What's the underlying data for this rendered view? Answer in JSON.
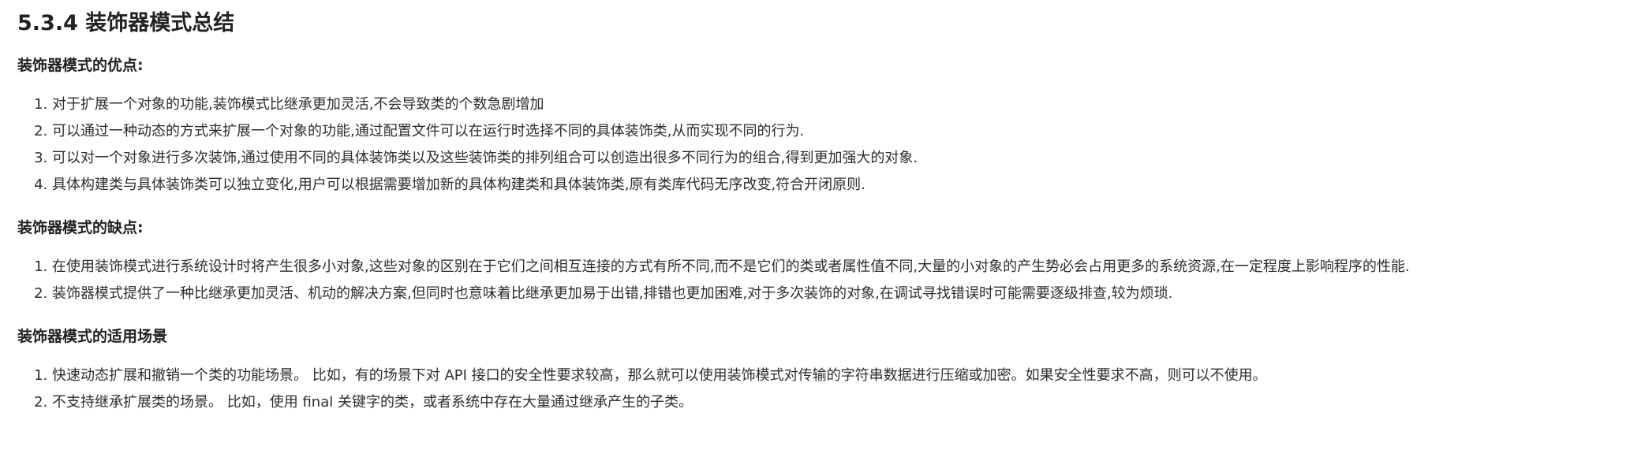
{
  "title": "5.3.4 装饰器模式总结",
  "sections": [
    {
      "heading": "装饰器模式的优点:",
      "items": [
        "对于扩展一个对象的功能,装饰模式比继承更加灵活,不会导致类的个数急剧增加",
        "可以通过一种动态的方式来扩展一个对象的功能,通过配置文件可以在运行时选择不同的具体装饰类,从而实现不同的行为.",
        "可以对一个对象进行多次装饰,通过使用不同的具体装饰类以及这些装饰类的排列组合可以创造出很多不同行为的组合,得到更加强大的对象.",
        "具体构建类与具体装饰类可以独立变化,用户可以根据需要增加新的具体构建类和具体装饰类,原有类库代码无序改变,符合开闭原则."
      ]
    },
    {
      "heading": "装饰器模式的缺点:",
      "items": [
        "在使用装饰模式进行系统设计时将产生很多小对象,这些对象的区别在于它们之间相互连接的方式有所不同,而不是它们的类或者属性值不同,大量的小对象的产生势必会占用更多的系统资源,在一定程度上影响程序的性能.",
        "装饰器模式提供了一种比继承更加灵活、机动的解决方案,但同时也意味着比继承更加易于出错,排错也更加困难,对于多次装饰的对象,在调试寻找错误时可能需要逐级排查,较为烦琐."
      ]
    },
    {
      "heading": "装饰器模式的适用场景",
      "items": [
        "快速动态扩展和撤销一个类的功能场景。 比如，有的场景下对 API 接口的安全性要求较高，那么就可以使用装饰模式对传输的字符串数据进行压缩或加密。如果安全性要求不高，则可以不使用。",
        "不支持继承扩展类的场景。 比如，使用 final 关键字的类，或者系统中存在大量通过继承产生的子类。"
      ]
    }
  ]
}
